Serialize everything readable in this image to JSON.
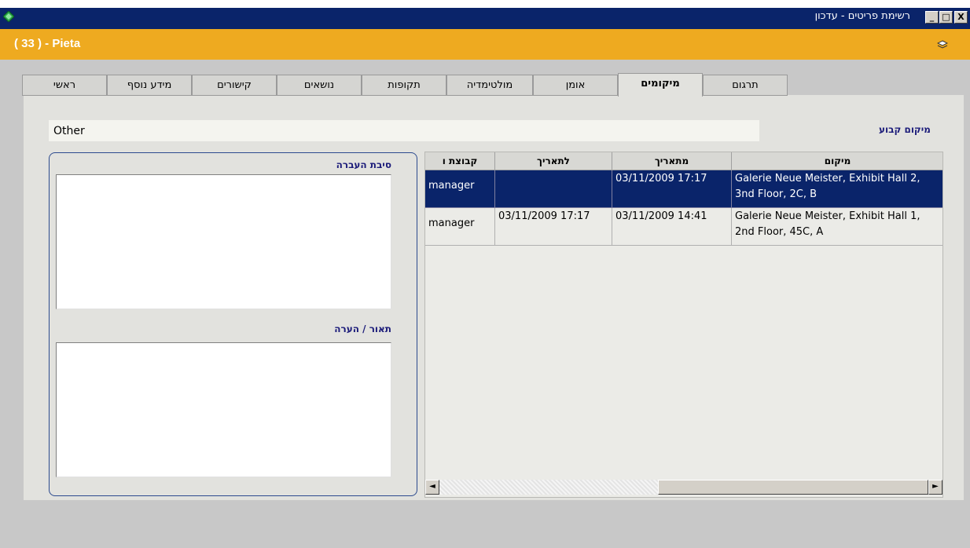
{
  "window": {
    "title": "רשימת פריטים - עדכון",
    "buttons": {
      "minimize": "_",
      "maximize": "□",
      "close": "X"
    }
  },
  "header": {
    "title": "( 33 ) - Pieta",
    "icon": "layers-icon"
  },
  "tabs": [
    {
      "label": "ראשי",
      "active": false
    },
    {
      "label": "מידע נוסף",
      "active": false
    },
    {
      "label": "קישורים",
      "active": false
    },
    {
      "label": "נושאים",
      "active": false
    },
    {
      "label": "תקופות",
      "active": false
    },
    {
      "label": "מולטימדיה",
      "active": false
    },
    {
      "label": "אומן",
      "active": false
    },
    {
      "label": "מיקומים",
      "active": true
    },
    {
      "label": "תרגום",
      "active": false
    }
  ],
  "fixed_location": {
    "label": "מיקום קבוע",
    "value": "Other"
  },
  "left_panel": {
    "transfer_reason_label": "סיבת העברה",
    "transfer_reason_value": "",
    "description_label": "תאור / הערה",
    "description_value": ""
  },
  "grid": {
    "columns": [
      "מיקום",
      "מתאריך",
      "לתאריך",
      "קבוצת ו"
    ],
    "rows": [
      {
        "location": "Galerie Neue Meister, Exhibit Hall 2, 3nd Floor, 2C, B",
        "from": "03/11/2009 17:17",
        "to": "",
        "group": "manager",
        "selected": true
      },
      {
        "location": "Galerie Neue Meister, Exhibit Hall 1, 2nd Floor, 45C, A",
        "from": "03/11/2009 14:41",
        "to": "03/11/2009 17:17",
        "group": "manager",
        "selected": false
      }
    ],
    "scroll_left": "◄",
    "scroll_right": "►"
  },
  "colors": {
    "titlebar": "#0a246a",
    "header": "#eeaa20",
    "selected_row": "#0a246a",
    "label_blue": "#1c1c7a"
  }
}
